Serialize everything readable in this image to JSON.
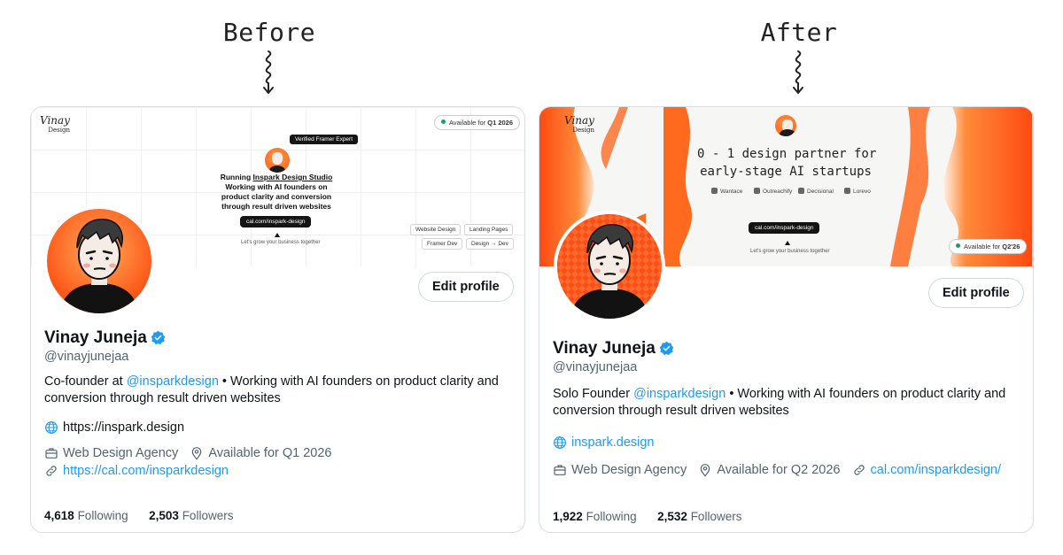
{
  "labels": {
    "before": "Before",
    "after": "After"
  },
  "before": {
    "banner": {
      "logo": "Vinay",
      "logo_sub": "Design",
      "availability": "Available for Q1 2026",
      "availability_prefix": "Available for ",
      "availability_bold": "Q1 2026",
      "verified": "Verified Framer Expert",
      "line1_prefix": "Running ",
      "line1_link": "Inspark Design Studio",
      "line2": "Working with AI founders on",
      "line3": "product clarity and conversion",
      "line4": "through result driven websites",
      "cta": "cal.com/inspark-design",
      "tagline": "Let's grow your business together",
      "tags": [
        "Website Design",
        "Landing Pages",
        "Framer Dev",
        "Design → Dev"
      ]
    },
    "edit_button": "Edit profile",
    "name": "Vinay Juneja",
    "handle": "@vinayjunejaa",
    "bio_prefix": "Co-founder at ",
    "bio_mention": "@insparkdesign",
    "bio_rest": " • Working with AI founders on product clarity and conversion through result driven websites",
    "website": "https://inspark.design",
    "category": "Web Design Agency",
    "location": "Available for Q1 2026",
    "link": "https://cal.com/insparkdesign",
    "following_count": "4,618",
    "following_label": "Following",
    "followers_count": "2,503",
    "followers_label": "Followers"
  },
  "after": {
    "banner": {
      "logo": "Vinay",
      "logo_sub": "Design",
      "headline1": "0 - 1 design partner for",
      "headline2": "early-stage AI startups",
      "brands": [
        "Wantace",
        "Outreachify",
        "Decisional",
        "Lorevo"
      ],
      "cta": "cal.com/inspark-design",
      "tagline": "Let's grow your business together",
      "availability_prefix": "Available for ",
      "availability_bold": "Q2'26"
    },
    "edit_button": "Edit profile",
    "name": "Vinay Juneja",
    "handle": "@vinayjunejaa",
    "bio_prefix": "Solo Founder ",
    "bio_mention": "@insparkdesign",
    "bio_rest": " • Working with AI founders on product clarity and conversion through result driven websites",
    "website": "inspark.design",
    "category": "Web Design Agency",
    "location": "Available for Q2 2026",
    "link": "cal.com/insparkdesign/",
    "following_count": "1,922",
    "following_label": "Following",
    "followers_count": "2,532",
    "followers_label": "Followers"
  },
  "colors": {
    "accent_blue": "#1d9bf0",
    "orange": "#ff5a14",
    "text_muted": "#536471"
  },
  "icons": [
    "squiggle-arrow-icon",
    "verified-badge-icon",
    "globe-icon",
    "briefcase-icon",
    "location-icon",
    "link-icon"
  ]
}
